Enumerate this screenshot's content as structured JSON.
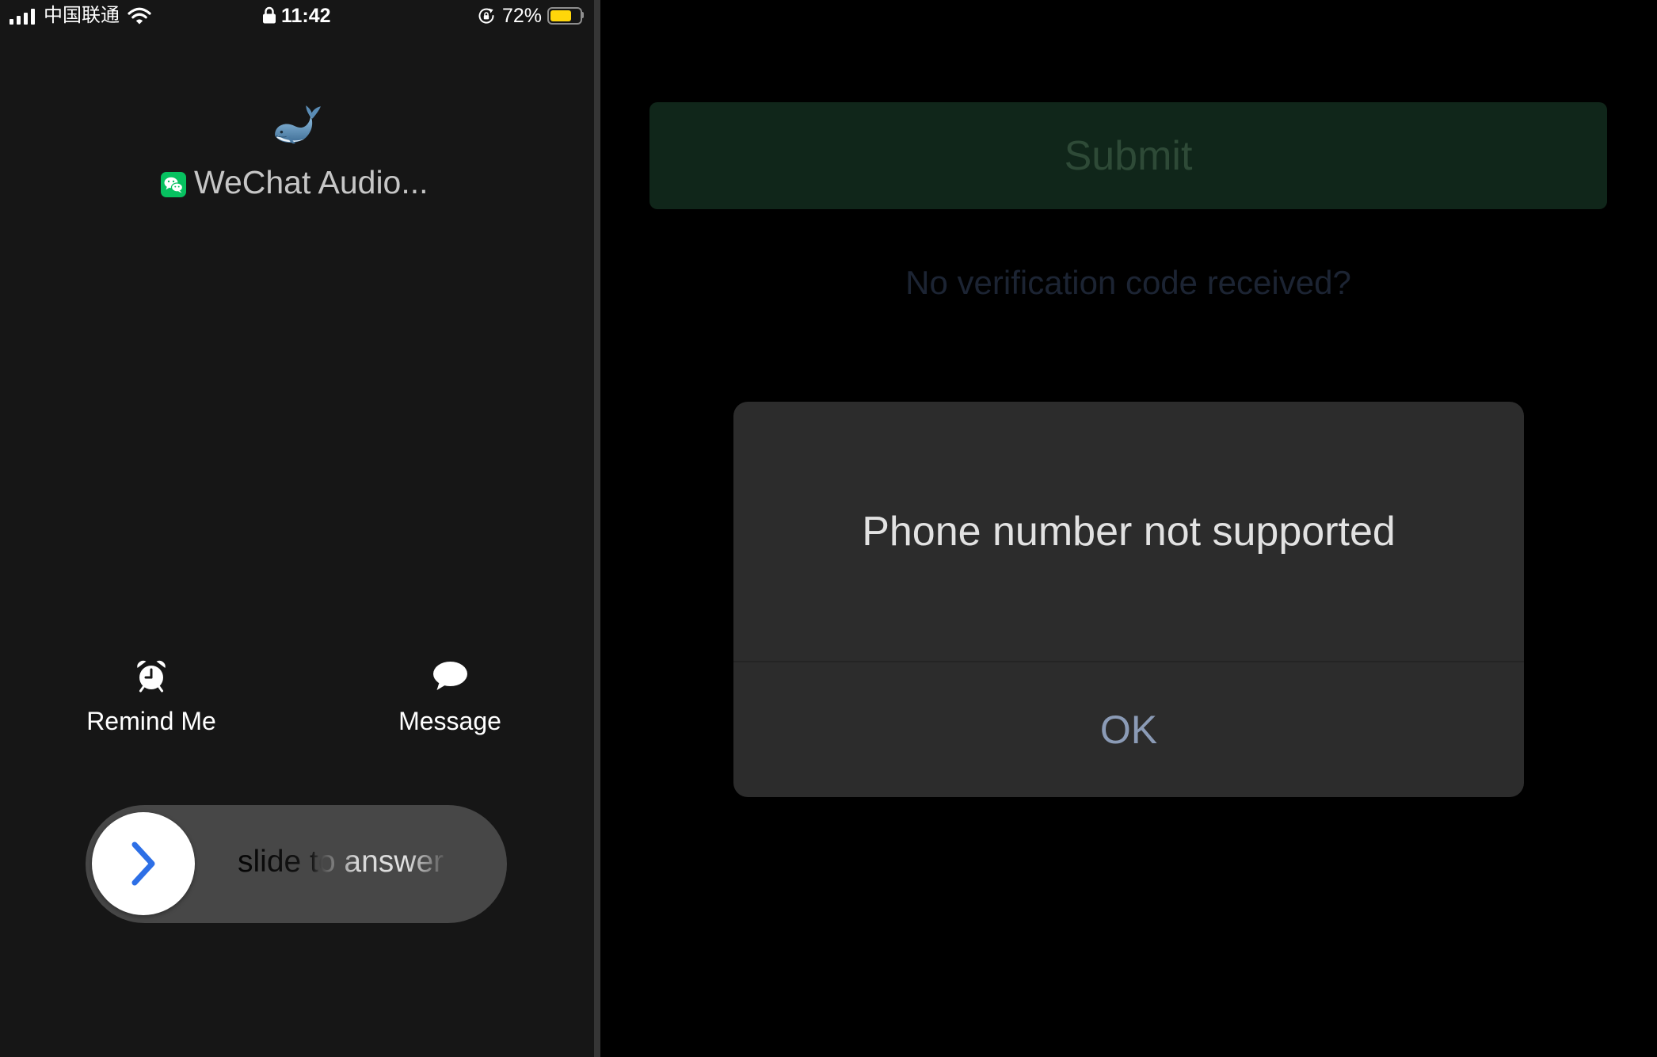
{
  "status_bar": {
    "carrier": "中国联通",
    "time": "11:42",
    "battery_percent": "72%",
    "battery_level": 0.72,
    "signal_bars": 4,
    "icons": {
      "signal": "signal-bars-icon",
      "wifi": "wifi-icon",
      "lock": "lock-icon",
      "rotation_lock": "rotation-lock-icon",
      "battery": "battery-icon"
    }
  },
  "incoming_call": {
    "caller_name": "WeChat Audio...",
    "avatar_icon": "whale-icon",
    "app_icon": "wechat-icon"
  },
  "call_actions": [
    {
      "label": "Remind Me",
      "icon": "alarm-clock-icon"
    },
    {
      "label": "Message",
      "icon": "message-bubble-icon"
    }
  ],
  "answer_slider": {
    "label": "slide to answer",
    "icon": "chevron-right-icon"
  },
  "background_screen": {
    "submit_label": "Submit",
    "resend_link": "No verification code received?"
  },
  "alert": {
    "message": "Phone number not supported",
    "ok_label": "OK"
  },
  "colors": {
    "left_pane_bg": "#161616",
    "pane_divider": "#353535",
    "submit_bg": "#10261a",
    "submit_text": "#2e4a37",
    "resend_text": "#1c2433",
    "alert_bg": "#2c2c2c",
    "alert_text": "#e2e2e2",
    "alert_ok_text": "#8b9bb6",
    "wechat_green": "#07c160",
    "slider_bg": "#474747",
    "slider_chevron": "#2d6fe6",
    "battery_fill": "#ffd60a"
  }
}
